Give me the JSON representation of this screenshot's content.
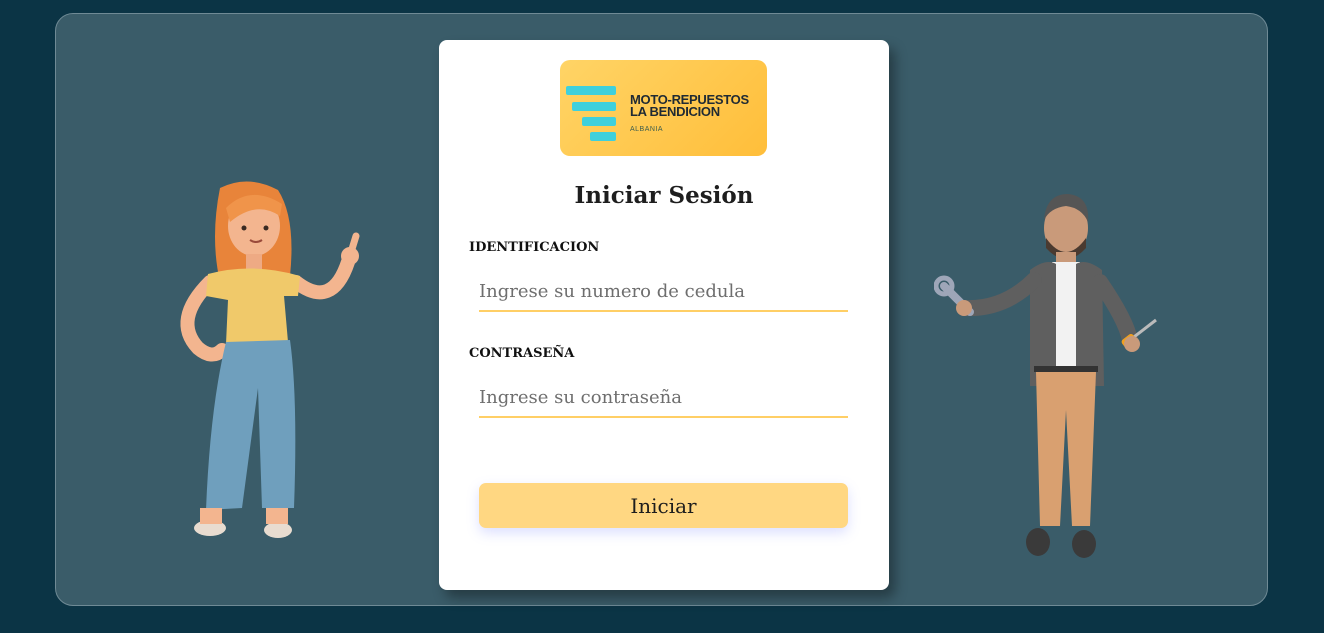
{
  "brand": {
    "name_line1": "MOTO-REPUESTOS",
    "name_line2": "LA BENDICION",
    "location": "ALBANIA",
    "accent": "#3fd0dc",
    "logo_bg": "#ffc646"
  },
  "login": {
    "title": "Iniciar Sesión",
    "id_label": "IDENTIFICACION",
    "id_placeholder": "Ingrese su numero de cedula",
    "id_value": "",
    "password_label": "CONTRASEÑA",
    "password_placeholder": "Ingrese su contraseña",
    "password_value": "",
    "submit_label": "Iniciar"
  },
  "illustrations": {
    "left": "woman-pointing-illustration",
    "right": "mechanic-with-tools-illustration"
  },
  "colors": {
    "page_bg": "#0b3445",
    "panel_bg": "#3a5c69",
    "button_bg": "#ffd782",
    "input_underline": "#ffcf66"
  }
}
